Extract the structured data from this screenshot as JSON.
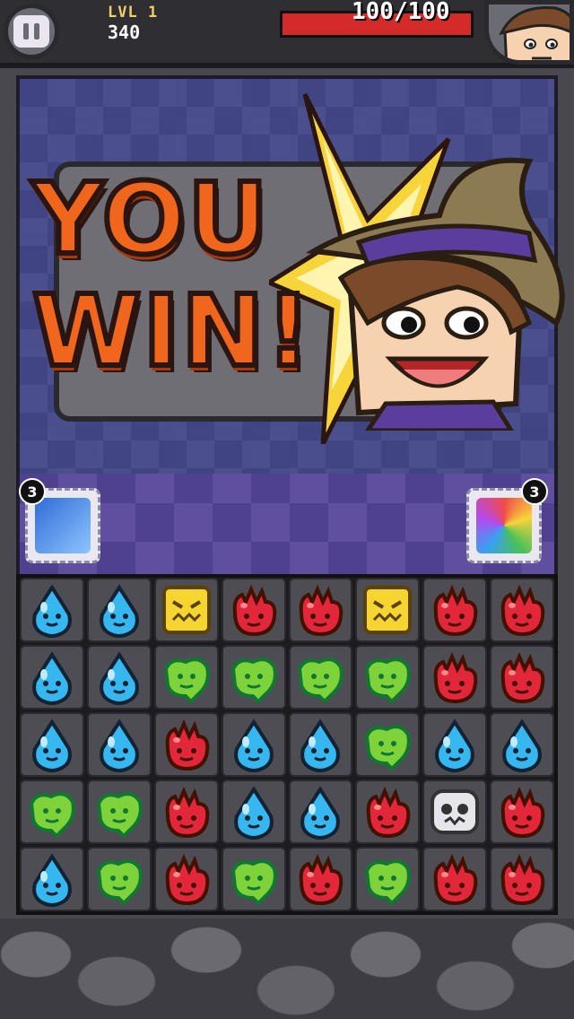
{
  "hud": {
    "level": "LVL 1",
    "score": "340",
    "hp_text": "100/100",
    "hp_fraction": 1.0
  },
  "banner": {
    "line1": "YOU",
    "line2": "WIN!"
  },
  "powerups": {
    "left": {
      "icon": "meteor-icon",
      "count": "3"
    },
    "right": {
      "icon": "rainbow-ufo-icon",
      "count": "3"
    }
  },
  "colors": {
    "blue": "#36b7f0",
    "green": "#7ed33a",
    "red": "#e2273a",
    "yellow": "#f6d431",
    "skull": "#e6e6ea"
  },
  "board": [
    [
      "blue",
      "blue",
      "yellow",
      "red",
      "red",
      "yellow",
      "red",
      "red"
    ],
    [
      "blue",
      "blue",
      "green",
      "green",
      "green",
      "green",
      "red",
      "red"
    ],
    [
      "blue",
      "blue",
      "red",
      "blue",
      "blue",
      "green",
      "blue",
      "blue"
    ],
    [
      "green",
      "green",
      "red",
      "blue",
      "blue",
      "red",
      "skull",
      "red"
    ],
    [
      "blue",
      "green",
      "red",
      "green",
      "red",
      "green",
      "red",
      "red"
    ]
  ]
}
